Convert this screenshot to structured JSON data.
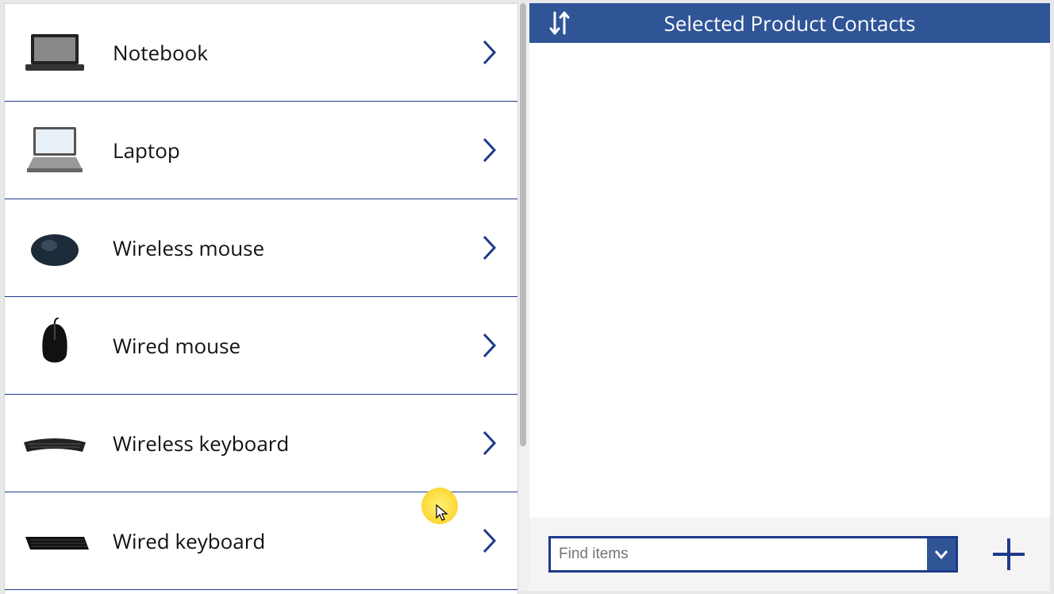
{
  "left": {
    "products": [
      {
        "label": "Notebook",
        "thumb": "laptop-closed"
      },
      {
        "label": "Laptop",
        "thumb": "laptop-open"
      },
      {
        "label": "Wireless mouse",
        "thumb": "mouse-round"
      },
      {
        "label": "Wired mouse",
        "thumb": "mouse-wired"
      },
      {
        "label": "Wireless keyboard",
        "thumb": "keyboard-curve"
      },
      {
        "label": "Wired keyboard",
        "thumb": "keyboard-flat"
      }
    ]
  },
  "right": {
    "title": "Selected Product Contacts",
    "find_placeholder": "Find items"
  },
  "colors": {
    "accent": "#2f5597",
    "border": "#1e3a8a"
  }
}
